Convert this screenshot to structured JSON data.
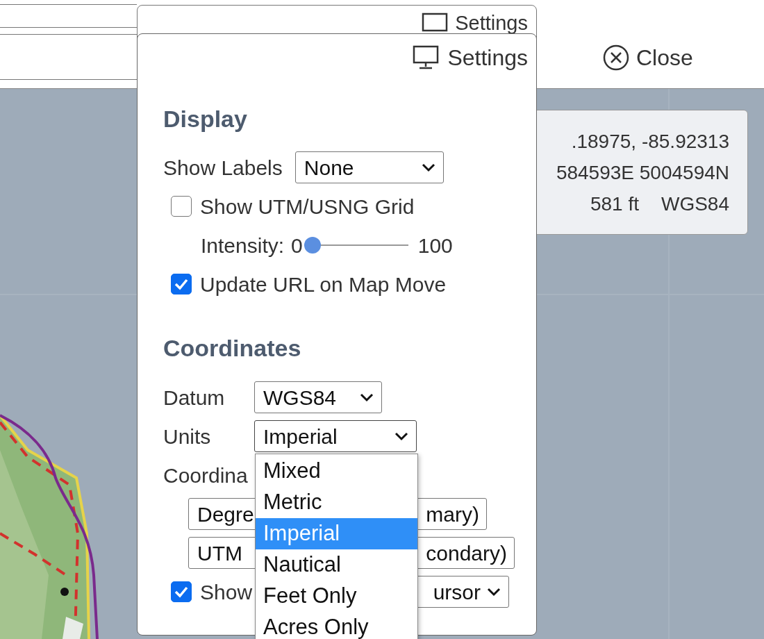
{
  "ghost_header": {
    "title": "Settings"
  },
  "close_button": {
    "label": "Close"
  },
  "coordinate_readout": {
    "lines": [
      ".18975, -85.92313",
      "584593E 5004594N"
    ],
    "elevation": "581 ft",
    "datum": "WGS84"
  },
  "settings_panel": {
    "title": "Settings",
    "display": {
      "heading": "Display",
      "show_labels": {
        "label": "Show Labels",
        "value": "None"
      },
      "grid": {
        "label": "Show UTM/USNG Grid",
        "checked": false
      },
      "intensity": {
        "label": "Intensity:",
        "min": "0",
        "max": "100",
        "level": 0
      },
      "update_url": {
        "label": "Update URL on Map Move",
        "checked": true
      }
    },
    "coordinates": {
      "heading": "Coordinates",
      "datum": {
        "label": "Datum",
        "value": "WGS84"
      },
      "units": {
        "label": "Units",
        "value": "Imperial",
        "expanded": true,
        "options": [
          {
            "label": "Mixed",
            "selected": false
          },
          {
            "label": "Metric",
            "selected": false
          },
          {
            "label": "Imperial",
            "selected": true
          },
          {
            "label": "Nautical",
            "selected": false
          },
          {
            "label": "Feet Only",
            "selected": false
          },
          {
            "label": "Acres Only",
            "selected": false
          }
        ]
      },
      "format_label": "Coordina",
      "primary": {
        "left": "Degre",
        "right": "mary)"
      },
      "secondary": {
        "left": "UTM",
        "right": "condary)"
      },
      "show_row": {
        "label": "Show",
        "checked": true,
        "select_right": "ursor"
      }
    }
  }
}
